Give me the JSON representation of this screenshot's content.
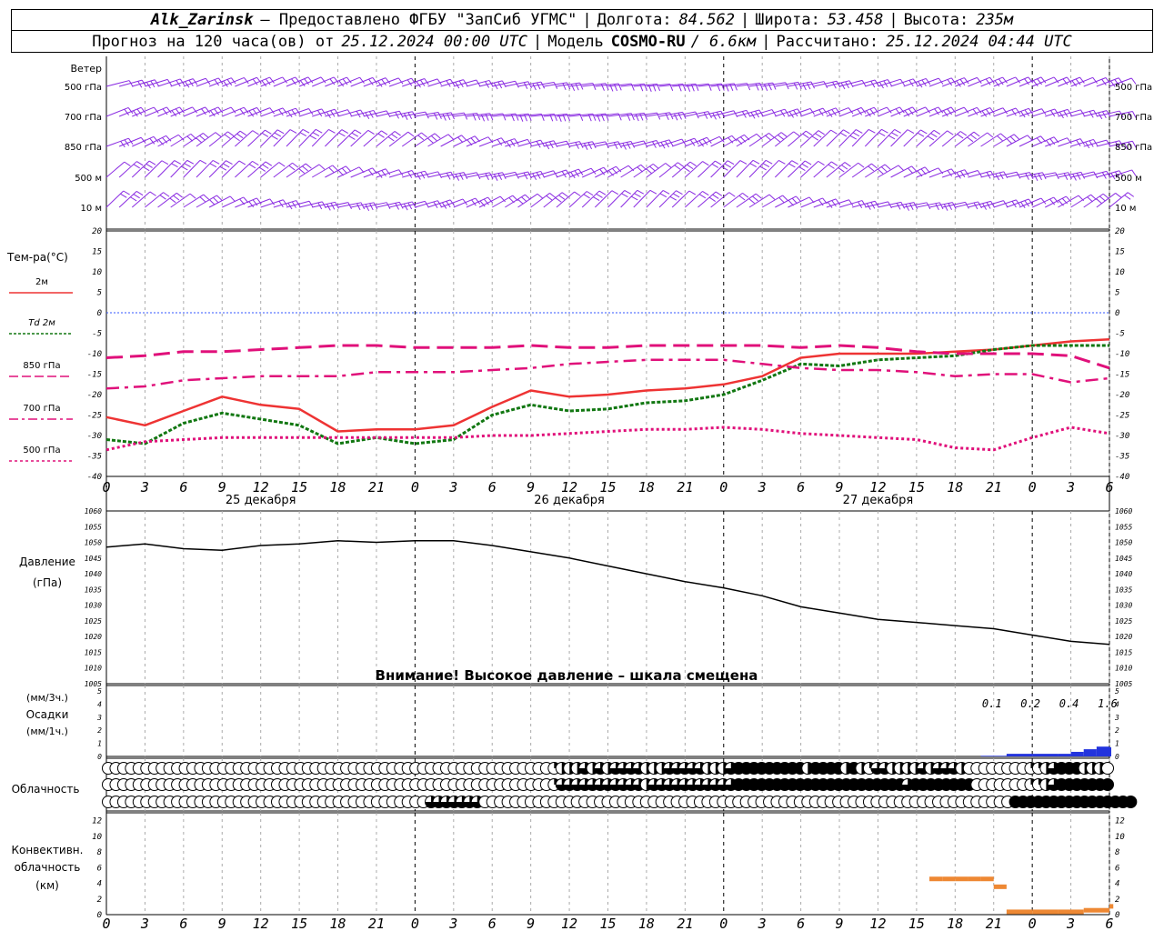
{
  "header": {
    "station": "Alk_Zarinsk",
    "provider": "– Предоставлено ФГБУ \"ЗапСиб УГМС\"",
    "lon_label": "Долгота:",
    "lon": "84.562",
    "lat_label": "Широта:",
    "lat": "53.458",
    "alt_label": "Высота:",
    "alt": "235м",
    "forecast_label": "Прогноз на 120 часа(ов) от",
    "forecast_time": "25.12.2024 00:00 UTC",
    "model_label": "Модель",
    "model": "COSMO-RU",
    "model_res": "/ 6.6км",
    "calc_label": "Рассчитано:",
    "calc_time": "25.12.2024 04:44 UTC"
  },
  "colors": {
    "wind": "#8a2be2",
    "t2m": "#ee3333",
    "td2m": "#117711",
    "t850": "#e0107a",
    "t700": "#e0107a",
    "t500": "#e0107a",
    "zero_line": "#3355ff",
    "pressure": "#000000",
    "precip": "#2233dd",
    "convective": "#ee8833",
    "grid": "#999999"
  },
  "time_axis": {
    "hour_labels": [
      "0",
      "3",
      "6",
      "9",
      "12",
      "15",
      "18",
      "21",
      "0",
      "3",
      "6",
      "9",
      "12",
      "15",
      "18",
      "21",
      "0",
      "3",
      "6",
      "9",
      "12",
      "15",
      "18",
      "21",
      "0",
      "3",
      "6"
    ],
    "day_labels": [
      "25 декабря",
      "26 декабря",
      "27 декабря"
    ]
  },
  "wind_panel": {
    "title": "Ветер",
    "levels": [
      "500 гПа",
      "700 гПа",
      "850 гПа",
      "500 м",
      "10  м"
    ]
  },
  "temp_panel": {
    "title": "Тем-ра(°C)",
    "legend": [
      "2м",
      "Td  2м",
      "850 гПа",
      "700 гПа",
      "500 гПа"
    ],
    "y_ticks": [
      "20",
      "15",
      "10",
      "5",
      "0",
      "-5",
      "-10",
      "-15",
      "-20",
      "-25",
      "-30",
      "-35",
      "-40"
    ]
  },
  "pressure_panel": {
    "title_line1": "Давление",
    "title_line2": "(гПа)",
    "y_ticks": [
      "1060",
      "1055",
      "1050",
      "1045",
      "1040",
      "1035",
      "1030",
      "1025",
      "1020",
      "1015",
      "1010",
      "1005"
    ],
    "warning": "Внимание! Высокое давление – шкала смещена"
  },
  "precip_panel": {
    "unit3h": "(мм/3ч.)",
    "title": "Осадки",
    "unit1h": "(мм/1ч.)",
    "y_ticks": [
      "5",
      "4",
      "3",
      "2",
      "1",
      "0"
    ],
    "totals": [
      "0.1",
      "0.2",
      "0.4",
      "1.6"
    ]
  },
  "cloud_panel": {
    "title": "Облачность"
  },
  "conv_panel": {
    "title_line1": "Конвективн.",
    "title_line2": "облачность",
    "title_line3": "(км)",
    "y_ticks": [
      "12",
      "10",
      "8",
      "6",
      "4",
      "2",
      "0"
    ]
  },
  "chart_data": {
    "type": "line",
    "x_hours": [
      0,
      3,
      6,
      9,
      12,
      15,
      18,
      21,
      24,
      27,
      30,
      33,
      36,
      39,
      42,
      45,
      48,
      51,
      54,
      57,
      60,
      63,
      66,
      69,
      72,
      75,
      78
    ],
    "series": [
      {
        "name": "2м",
        "unit": "°C",
        "values": [
          -25.5,
          -27.5,
          -24,
          -20.5,
          -22.5,
          -23.5,
          -29,
          -28.5,
          -28.5,
          -27.5,
          -23,
          -19,
          -20.5,
          -20,
          -19,
          -18.5,
          -17.5,
          -15.5,
          -11,
          -10,
          -10,
          -10,
          -9.5,
          -9,
          -8,
          -7,
          -6.5
        ]
      },
      {
        "name": "Td  2м",
        "unit": "°C",
        "values": [
          -31,
          -32,
          -27,
          -24.5,
          -26,
          -27.5,
          -32,
          -30.5,
          -32,
          -31,
          -25,
          -22.5,
          -24,
          -23.5,
          -22,
          -21.5,
          -20,
          -16.5,
          -12.5,
          -13,
          -11.5,
          -11,
          -10.5,
          -9,
          -8,
          -8,
          -8
        ]
      },
      {
        "name": "850 гПа",
        "unit": "°C",
        "values": [
          -11,
          -10.5,
          -9.5,
          -9.5,
          -9,
          -8.5,
          -8,
          -8,
          -8.5,
          -8.5,
          -8.5,
          -8,
          -8.5,
          -8.5,
          -8,
          -8,
          -8,
          -8,
          -8.5,
          -8,
          -8.5,
          -9.5,
          -10,
          -10,
          -10,
          -10.5,
          -13.5
        ]
      },
      {
        "name": "700 гПа",
        "unit": "°C",
        "values": [
          -18.5,
          -18,
          -16.5,
          -16,
          -15.5,
          -15.5,
          -15.5,
          -14.5,
          -14.5,
          -14.5,
          -14,
          -13.5,
          -12.5,
          -12,
          -11.5,
          -11.5,
          -11.5,
          -12.5,
          -13.5,
          -14,
          -14,
          -14.5,
          -15.5,
          -15,
          -15,
          -17,
          -16
        ]
      },
      {
        "name": "500 гПа",
        "unit": "°C",
        "values": [
          -33.5,
          -31.5,
          -31,
          -30.5,
          -30.5,
          -30.5,
          -30.5,
          -30.5,
          -30.5,
          -30.5,
          -30,
          -30,
          -29.5,
          -29,
          -28.5,
          -28.5,
          -28,
          -28.5,
          -29.5,
          -30,
          -30.5,
          -31,
          -33,
          -33.5,
          -30.5,
          -28,
          -29.5
        ]
      }
    ],
    "pressure": {
      "unit": "гПа",
      "values": [
        1048.5,
        1049.5,
        1048,
        1047.5,
        1049,
        1049.5,
        1050.5,
        1050,
        1050.5,
        1050.5,
        1049,
        1047,
        1045,
        1042.5,
        1040,
        1037.5,
        1035.5,
        1033,
        1029.5,
        1027.5,
        1025.5,
        1024.5,
        1023.5,
        1022.5,
        1020.5,
        1018.5,
        1017.5
      ],
      "ylim": [
        1005,
        1060
      ]
    },
    "precip_mm": {
      "x_hours": [
        68,
        70,
        72,
        74,
        75,
        76,
        77,
        78
      ],
      "values": [
        0.05,
        0.2,
        0.2,
        0.2,
        0.35,
        0.55,
        0.75,
        0.7
      ]
    },
    "convective_km": {
      "x_hours": [
        64,
        65,
        66,
        67,
        68,
        69,
        70,
        72,
        74,
        76,
        78
      ],
      "values": [
        4.5,
        4.5,
        4.5,
        4.5,
        4.5,
        3.5,
        0.3,
        0.3,
        0.3,
        0.5,
        1
      ]
    },
    "cloud_cover_rows": {
      "upper": [
        0,
        0,
        0,
        0,
        0,
        0,
        0,
        0,
        0,
        0,
        0,
        0,
        0,
        0,
        0,
        0,
        0,
        0,
        0,
        0,
        0,
        0,
        0,
        0,
        0,
        0,
        0,
        0,
        0,
        0,
        0,
        0,
        0,
        0,
        0,
        0,
        0,
        0,
        0,
        0,
        0,
        0,
        0,
        0,
        0,
        0,
        0,
        0,
        0,
        0,
        0,
        0,
        0,
        0,
        0,
        0,
        0,
        0,
        1,
        2,
        2,
        2,
        3,
        2,
        3,
        2,
        3,
        3,
        3,
        3,
        2,
        2,
        2,
        3,
        3,
        3,
        3,
        3,
        2,
        2,
        2,
        3,
        4,
        4,
        4,
        4,
        4,
        4,
        4,
        4,
        4,
        2,
        4,
        4,
        4,
        4,
        2,
        4,
        2,
        1,
        3,
        3,
        2,
        2,
        2,
        2,
        3,
        2,
        3,
        3,
        3,
        2,
        0,
        0,
        0,
        0,
        0,
        0,
        0,
        0,
        1,
        1,
        2,
        3,
        4,
        4,
        4,
        2,
        2,
        2,
        0
      ],
      "middle": [
        0,
        0,
        0,
        0,
        0,
        0,
        0,
        0,
        0,
        0,
        0,
        0,
        0,
        0,
        0,
        0,
        0,
        0,
        0,
        0,
        0,
        0,
        0,
        0,
        0,
        0,
        0,
        0,
        0,
        0,
        0,
        0,
        0,
        0,
        0,
        0,
        0,
        0,
        0,
        0,
        0,
        0,
        0,
        0,
        0,
        0,
        0,
        0,
        0,
        0,
        0,
        0,
        0,
        0,
        0,
        0,
        0,
        0,
        1,
        3,
        3,
        3,
        3,
        3,
        3,
        3,
        3,
        3,
        3,
        3,
        2,
        3,
        3,
        3,
        3,
        3,
        3,
        3,
        3,
        3,
        3,
        3,
        4,
        4,
        4,
        4,
        4,
        4,
        4,
        4,
        4,
        4,
        4,
        4,
        4,
        4,
        4,
        4,
        4,
        4,
        4,
        4,
        4,
        4,
        3,
        4,
        4,
        4,
        4,
        4,
        4,
        4,
        4,
        0,
        0,
        0,
        0,
        0,
        0,
        0,
        1,
        1,
        2,
        3,
        4,
        4,
        4,
        4,
        4,
        4,
        4
      ],
      "lower": [
        0,
        0,
        0,
        0,
        0,
        0,
        0,
        0,
        0,
        0,
        0,
        0,
        0,
        0,
        0,
        0,
        0,
        0,
        0,
        0,
        0,
        0,
        0,
        0,
        0,
        0,
        0,
        0,
        0,
        0,
        0,
        0,
        0,
        0,
        0,
        0,
        0,
        0,
        0,
        0,
        0,
        0,
        3,
        3,
        3,
        3,
        3,
        3,
        3,
        0,
        0,
        0,
        0,
        0,
        0,
        0,
        0,
        0,
        0,
        0,
        0,
        0,
        0,
        0,
        0,
        0,
        0,
        0,
        0,
        0,
        0,
        0,
        0,
        0,
        0,
        0,
        0,
        0,
        0,
        0,
        0,
        0,
        0,
        0,
        0,
        0,
        0,
        0,
        0,
        0,
        0,
        0,
        0,
        0,
        0,
        0,
        0,
        0,
        0,
        0,
        0,
        0,
        0,
        0,
        0,
        0,
        0,
        0,
        0,
        0,
        0,
        0,
        0,
        0,
        0,
        0,
        0,
        0,
        4,
        4,
        4,
        4,
        4,
        4,
        4,
        4,
        4,
        4,
        4,
        4,
        4,
        4,
        4,
        4
      ]
    },
    "temp_ylim": [
      -40,
      20
    ],
    "precip_ylim": [
      0,
      5
    ],
    "conv_ylim": [
      0,
      13
    ]
  }
}
